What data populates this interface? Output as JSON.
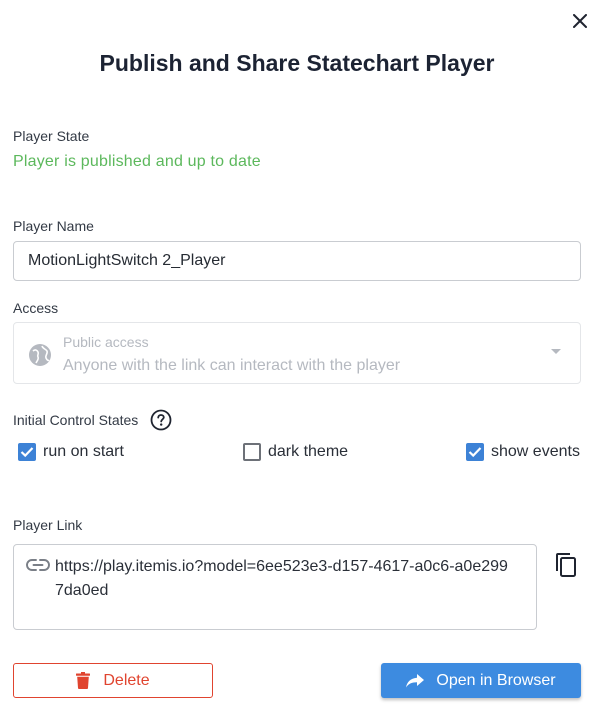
{
  "dialog": {
    "title": "Publish and Share Statechart Player",
    "close_icon": "close-icon"
  },
  "player_state": {
    "label": "Player State",
    "status": "Player is published and up to date",
    "status_color": "#5cb85c"
  },
  "player_name": {
    "label": "Player Name",
    "value": "MotionLightSwitch 2_Player"
  },
  "access": {
    "label": "Access",
    "icon": "globe-icon",
    "option_title": "Public access",
    "option_description": "Anyone with the link can interact with the player",
    "disabled": true
  },
  "initial_control_states": {
    "label": "Initial Control States",
    "help_icon": "help-circle-icon",
    "options": [
      {
        "label": "run on start",
        "checked": true
      },
      {
        "label": "dark theme",
        "checked": false
      },
      {
        "label": "show events",
        "checked": true
      }
    ]
  },
  "player_link": {
    "label": "Player Link",
    "icon": "link-icon",
    "url": "https://play.itemis.io?model=6ee523e3-d157-4617-a0c6-a0e2997da0ed",
    "copy_icon": "copy-icon"
  },
  "actions": {
    "delete_label": "Delete",
    "delete_icon": "trash-icon",
    "delete_color": "#e0442f",
    "open_label": "Open in Browser",
    "open_icon": "share-arrow-icon",
    "open_color": "#3d8be0"
  }
}
